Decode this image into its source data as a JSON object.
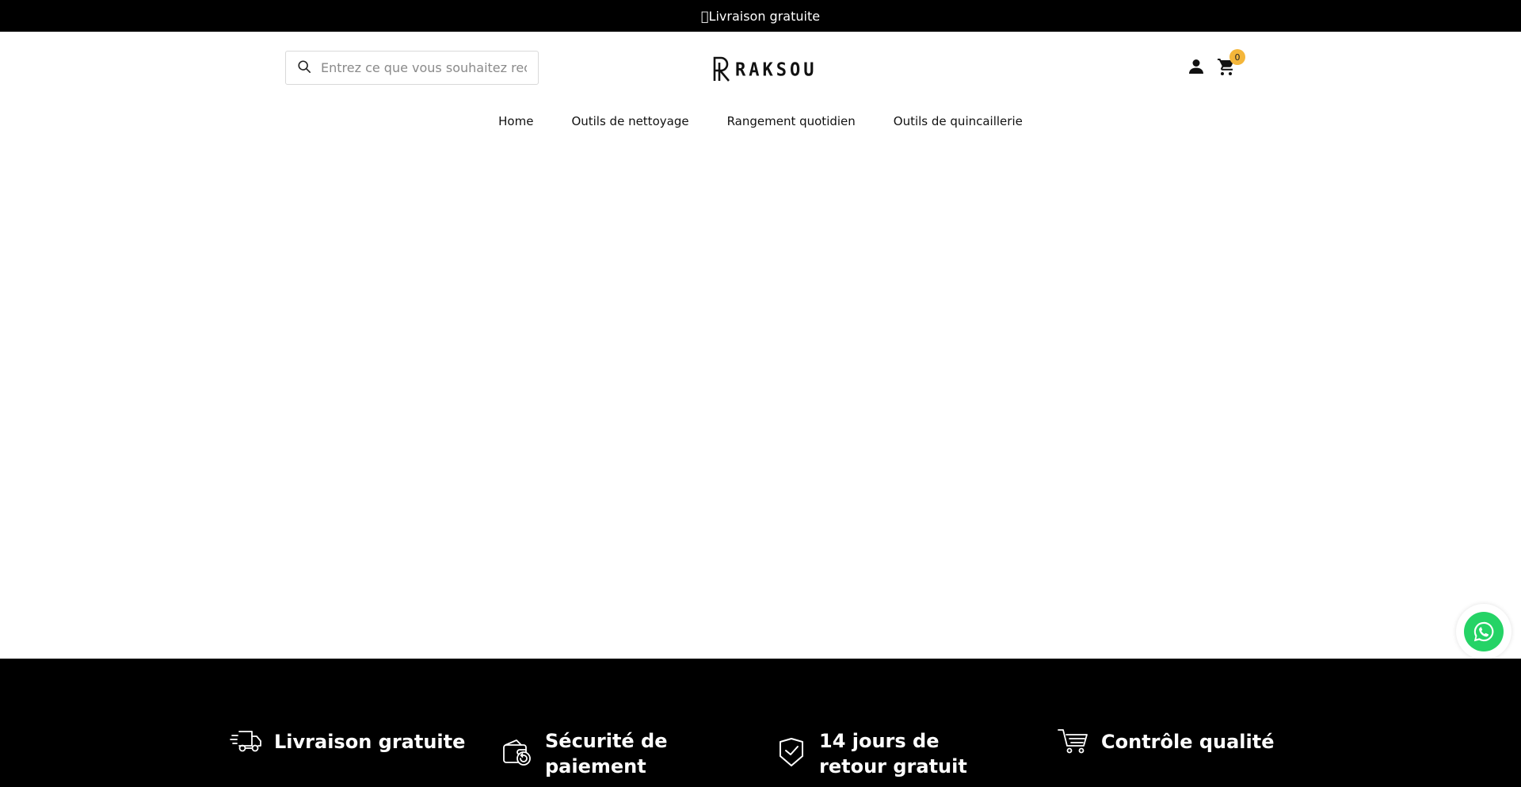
{
  "announcement": {
    "text": "\u0000Livraison gratuite"
  },
  "search": {
    "placeholder": "Entrez ce que vous souhaitez rec",
    "icon": "search-icon"
  },
  "logo": {
    "wordmark": "RAKSOU",
    "icon": "raksou-logo-icon"
  },
  "header_icons": {
    "account": "account-icon",
    "cart": "cart-icon",
    "cart_count": "0",
    "badge_color": "#f4b63a"
  },
  "nav": {
    "items": [
      {
        "label": "Home"
      },
      {
        "label": "Outils de nettoyage"
      },
      {
        "label": "Rangement quotidien"
      },
      {
        "label": "Outils de quincaillerie"
      }
    ]
  },
  "whatsapp": {
    "icon": "whatsapp-icon",
    "color": "#25d366"
  },
  "footer": {
    "features": [
      {
        "icon": "delivery-truck-icon",
        "label": "Livraison gratuite"
      },
      {
        "icon": "payment-return-icon",
        "label": "Sécurité de paiement"
      },
      {
        "icon": "shield-check-icon",
        "label": "14 jours de retour gratuit"
      },
      {
        "icon": "shopping-cart-icon",
        "label": "Contrôle qualité"
      }
    ]
  },
  "colors": {
    "announcement_bg": "#000000",
    "footer_bg": "#000000",
    "page_bg": "#ffffff"
  }
}
